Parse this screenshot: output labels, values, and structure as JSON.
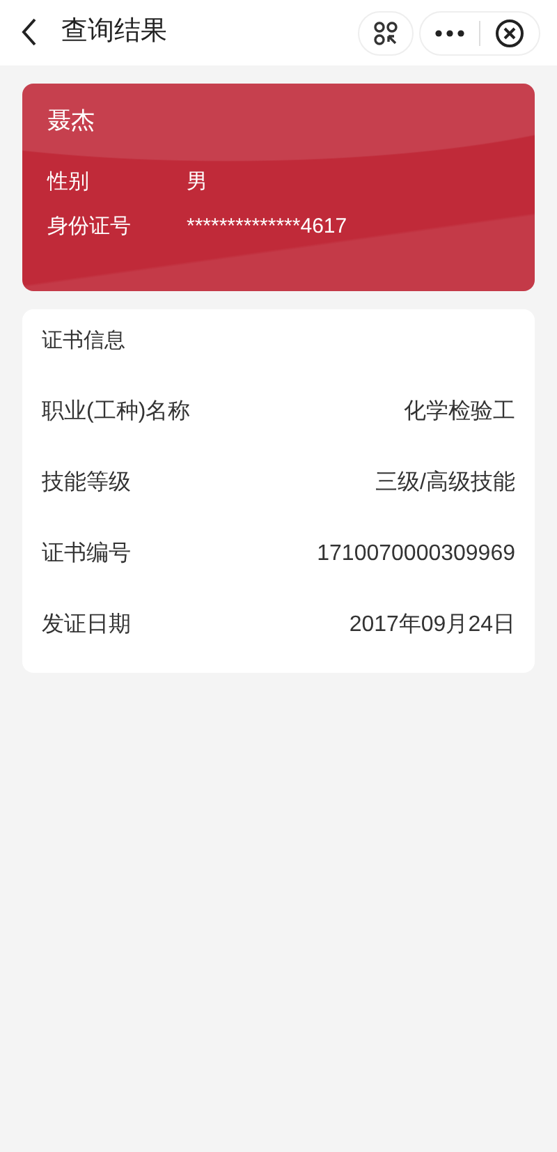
{
  "header": {
    "title": "查询结果"
  },
  "person": {
    "name": "聂杰",
    "fields": [
      {
        "label": "性别",
        "value": "男"
      },
      {
        "label": "身份证号",
        "value": "**************4617"
      }
    ]
  },
  "certificate": {
    "title": "证书信息",
    "rows": [
      {
        "label": "职业(工种)名称",
        "value": "化学检验工"
      },
      {
        "label": "技能等级",
        "value": "三级/高级技能"
      },
      {
        "label": "证书编号",
        "value": "1710070000309969"
      },
      {
        "label": "发证日期",
        "value": "2017年09月24日"
      }
    ]
  }
}
